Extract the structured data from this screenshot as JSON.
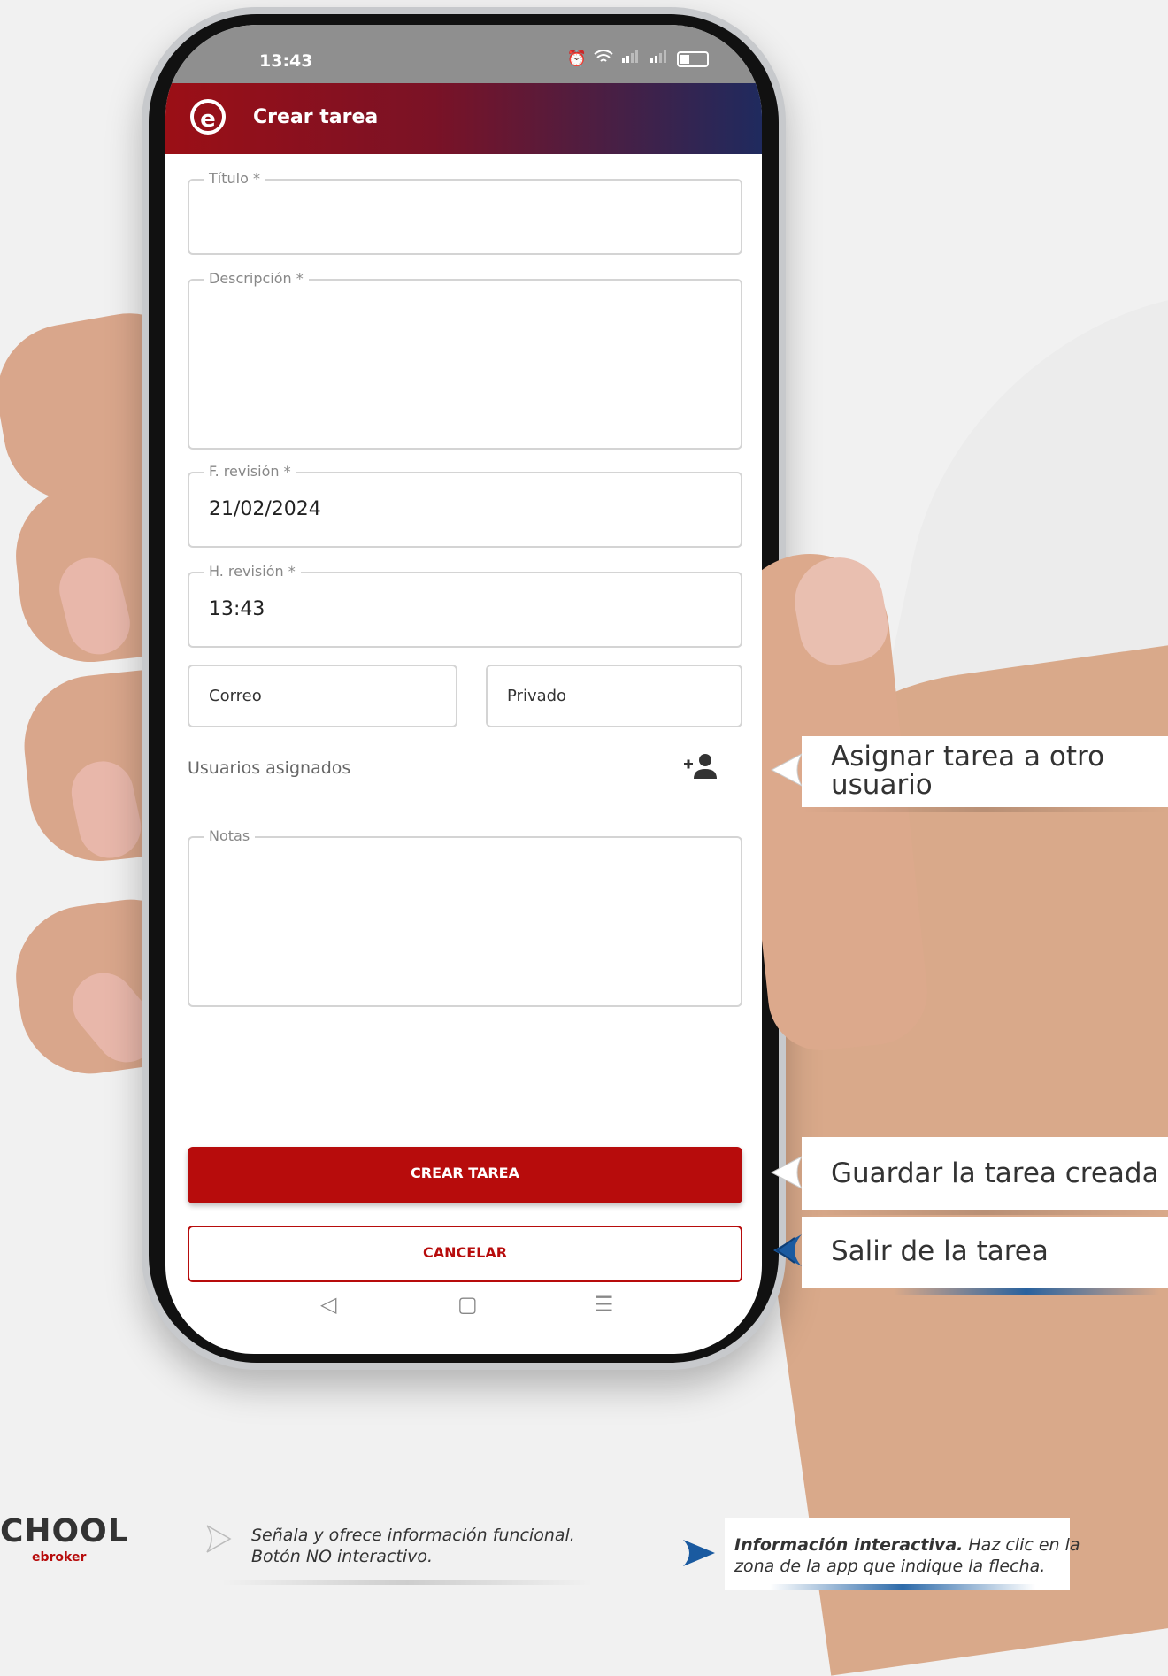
{
  "status_bar": {
    "time": "13:43"
  },
  "app_bar": {
    "logo_letter": "e",
    "title": "Crear tarea"
  },
  "form": {
    "titulo": {
      "label": "Título *",
      "value": ""
    },
    "descripcion": {
      "label": "Descripción *",
      "value": ""
    },
    "fecha_revision": {
      "label": "F. revisión *",
      "value": "21/02/2024"
    },
    "hora_revision": {
      "label": "H. revisión *",
      "value": "13:43"
    },
    "correo_label": "Correo",
    "privado_label": "Privado",
    "usuarios_asignados_label": "Usuarios asignados",
    "notas": {
      "label": "Notas",
      "value": ""
    }
  },
  "buttons": {
    "crear": "CREAR TAREA",
    "cancelar": "CANCELAR"
  },
  "callouts": {
    "asignar_line1": "Asignar tarea a otro",
    "asignar_line2": "usuario",
    "guardar": "Guardar la tarea creada",
    "salir": "Salir de la tarea"
  },
  "legend": {
    "brand_main": "CHOOL",
    "brand_sub": "ebroker",
    "non_interactive_line1": "Señala y ofrece información funcional.",
    "non_interactive_line2": "Botón NO interactivo.",
    "interactive_bold": "Información interactiva.",
    "interactive_rest": " Haz clic en la",
    "interactive_line2": "zona de la app que indique la flecha."
  },
  "colors": {
    "accent_red": "#b70c0c",
    "callout_blue": "#1a5aa0"
  }
}
